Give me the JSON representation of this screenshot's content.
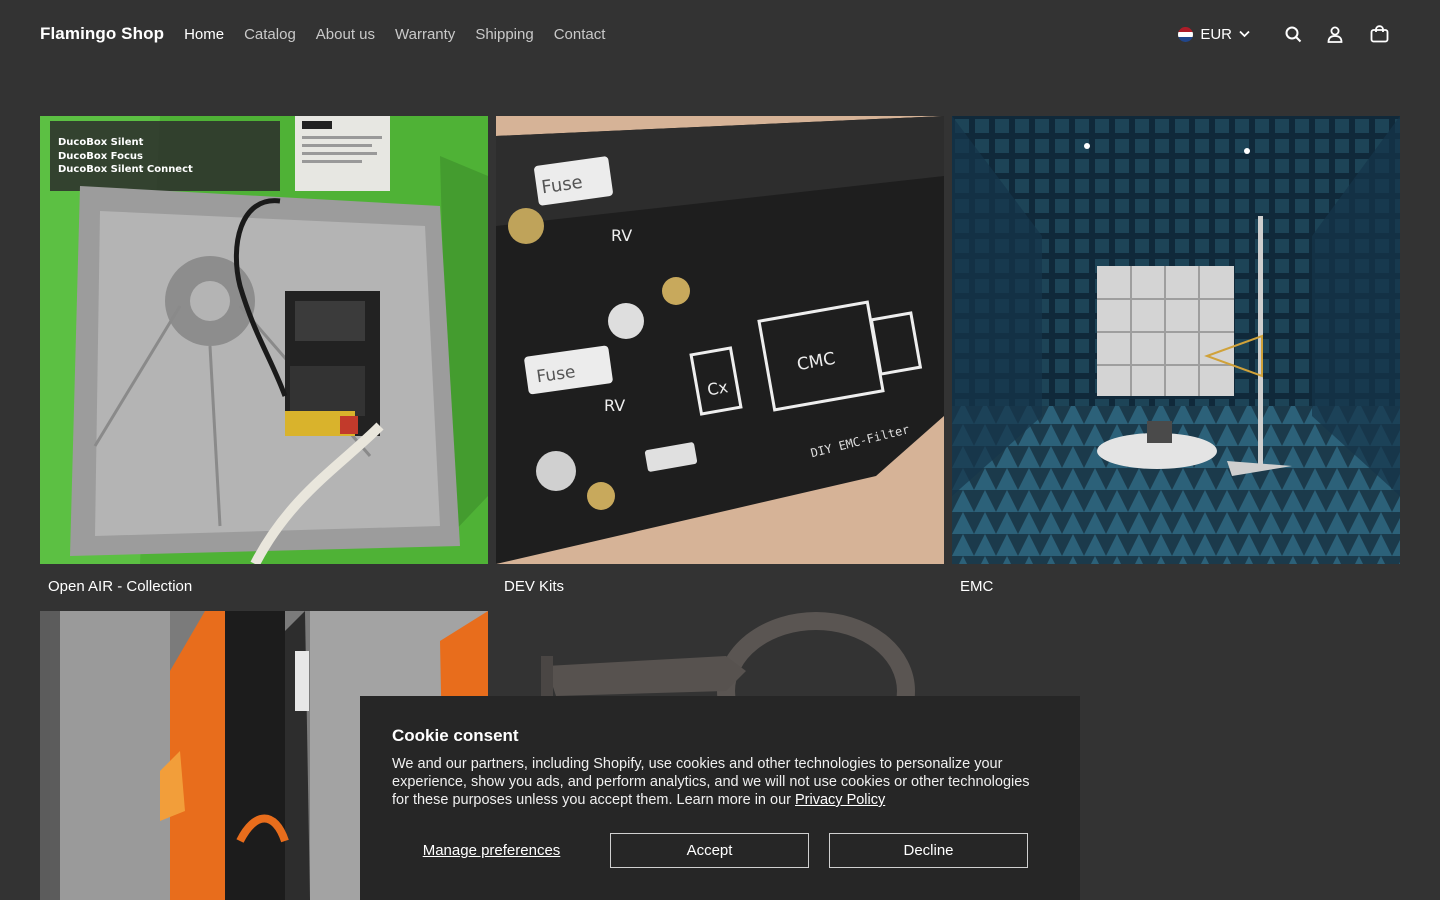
{
  "header": {
    "brand": "Flamingo Shop",
    "nav": [
      {
        "label": "Home",
        "active": true
      },
      {
        "label": "Catalog"
      },
      {
        "label": "About us"
      },
      {
        "label": "Warranty"
      },
      {
        "label": "Shipping"
      },
      {
        "label": "Contact"
      }
    ],
    "currency": "EUR",
    "icons": [
      "nl-flag-icon",
      "chevron-down-icon",
      "search-icon",
      "account-icon",
      "cart-icon"
    ]
  },
  "collections": [
    {
      "title": "Open AIR - Collection",
      "image_text": [
        "DucoBox Silent",
        "DucoBox Focus",
        "DucoBox Silent Connect"
      ]
    },
    {
      "title": "DEV Kits",
      "image_text": [
        "Fuse",
        "RV",
        "Cx",
        "CMC",
        "DIY EMC-Filter"
      ]
    },
    {
      "title": "EMC"
    },
    {
      "title": ""
    },
    {
      "title": ""
    }
  ],
  "cookie": {
    "title": "Cookie consent",
    "body": "We and our partners, including Shopify, use cookies and other technologies to personalize your experience, show you ads, and perform analytics, and we will not use cookies or other technologies for these purposes unless you accept them. Learn more in our ",
    "link": "Privacy Policy",
    "manage": "Manage preferences",
    "accept": "Accept",
    "decline": "Decline"
  },
  "colors": {
    "background": "#333333",
    "banner": "#262626",
    "text": "#ffffff"
  }
}
